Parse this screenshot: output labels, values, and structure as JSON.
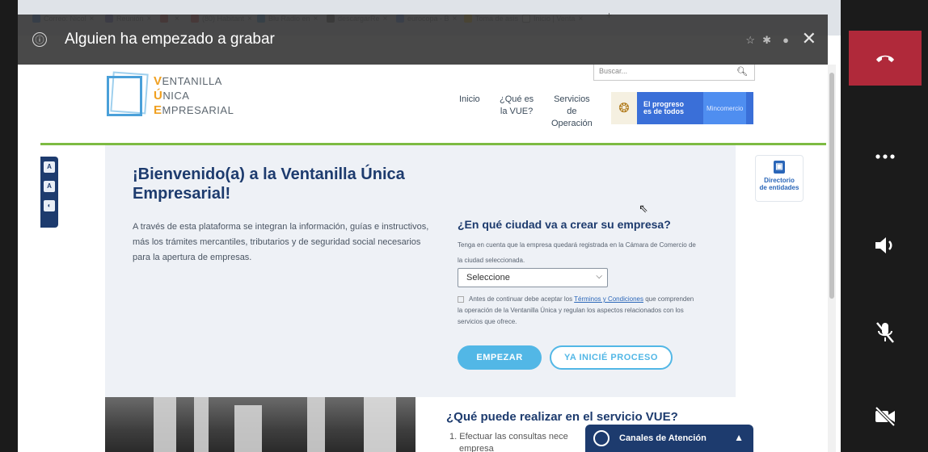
{
  "recording_banner": {
    "message": "Alguien ha empezado a grabar",
    "info_icon": "ⓘ"
  },
  "browser_tabs": [
    {
      "label": "Correo: Nicol",
      "color": "#1a73e8"
    },
    {
      "label": "Reunión",
      "color": "#5b5fc7"
    },
    {
      "label": "",
      "color": "#c62828"
    },
    {
      "label": "(80) Habitant",
      "color": "#e53935"
    },
    {
      "label": "Blu Radio en",
      "color": "#1e88e5"
    },
    {
      "label": "descargarRe",
      "color": "#424242"
    },
    {
      "label": "eurocopa - B",
      "color": "#4285f4"
    },
    {
      "label": "Toma de asis",
      "color": "#fbbc04"
    },
    {
      "label": "Inicio | Venta",
      "color": "#ffffff"
    }
  ],
  "site": {
    "logo": {
      "line1": "ENTANILLA",
      "line2": "NICA",
      "line3": "MPRESARIAL",
      "initial1": "V",
      "initial2": "Ú",
      "initial3": "E"
    },
    "search_placeholder": "Buscar...",
    "nav": [
      "Inicio",
      "¿Qué es\nla VUE?",
      "Servicios\nde\nOperación"
    ],
    "gov_text": "El progreso\nes de todos",
    "gov_ministry": "Mincomercio",
    "directorio": "Directorio\nde entidades"
  },
  "hero": {
    "title": "¡Bienvenido(a) a la Ventanilla Única Empresarial!",
    "intro": "A través de esta plataforma se integran la información, guías e instructivos, más los trámites mercantiles, tributarios y de seguridad social necesarios para la apertura de empresas.",
    "question": "¿En qué ciudad va a crear su empresa?",
    "hint": "Tenga en cuenta que la empresa quedará registrada en la Cámara de Comercio de la ciudad seleccionada.",
    "select_value": "Seleccione",
    "terms_pre": "Antes de continuar debe aceptar los ",
    "terms_link": "Términos y Condiciones",
    "terms_post": " que comprenden la operación de la Ventanilla Única y regulan los aspectos relacionados con los servicios que ofrece.",
    "btn_start": "EMPEZAR",
    "btn_existing": "YA INICIÉ PROCESO"
  },
  "services": {
    "title": "¿Qué puede realizar en el servicio VUE?",
    "item1": "1. Efectuar las consultas nece",
    "item1b": "empresa"
  },
  "canales": {
    "label": "Canales de Atención"
  }
}
